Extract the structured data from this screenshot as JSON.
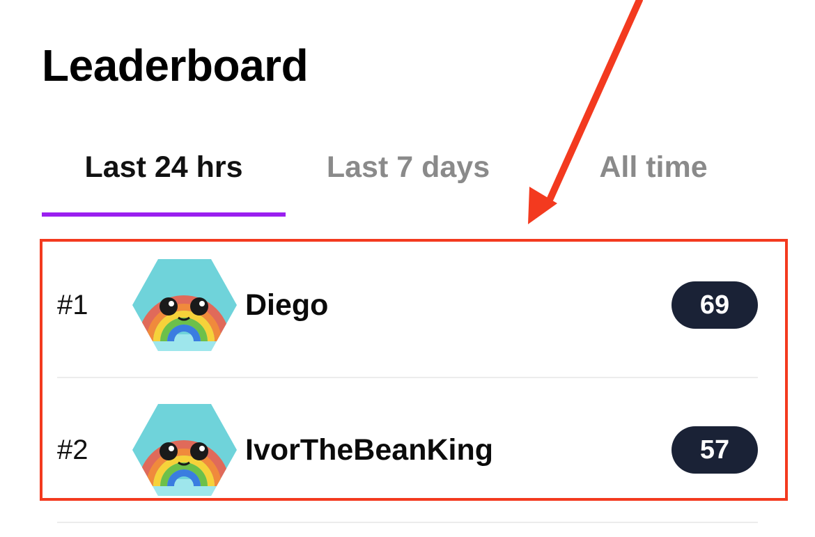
{
  "page": {
    "title": "Leaderboard"
  },
  "tabs": [
    {
      "label": "Last 24 hrs",
      "active": true
    },
    {
      "label": "Last 7 days",
      "active": false
    },
    {
      "label": "All time",
      "active": false
    }
  ],
  "leaderboard": {
    "rows": [
      {
        "rank": "#1",
        "name": "Diego",
        "score": "69",
        "avatar_icon": "rainbow-avatar-icon"
      },
      {
        "rank": "#2",
        "name": "IvorTheBeanKing",
        "score": "57",
        "avatar_icon": "rainbow-avatar-icon"
      }
    ]
  },
  "colors": {
    "accent": "#9a1ff0",
    "score_badge": "#1a2236",
    "annotation": "#f33a1f",
    "inactive_tab": "#8a8a8a"
  }
}
